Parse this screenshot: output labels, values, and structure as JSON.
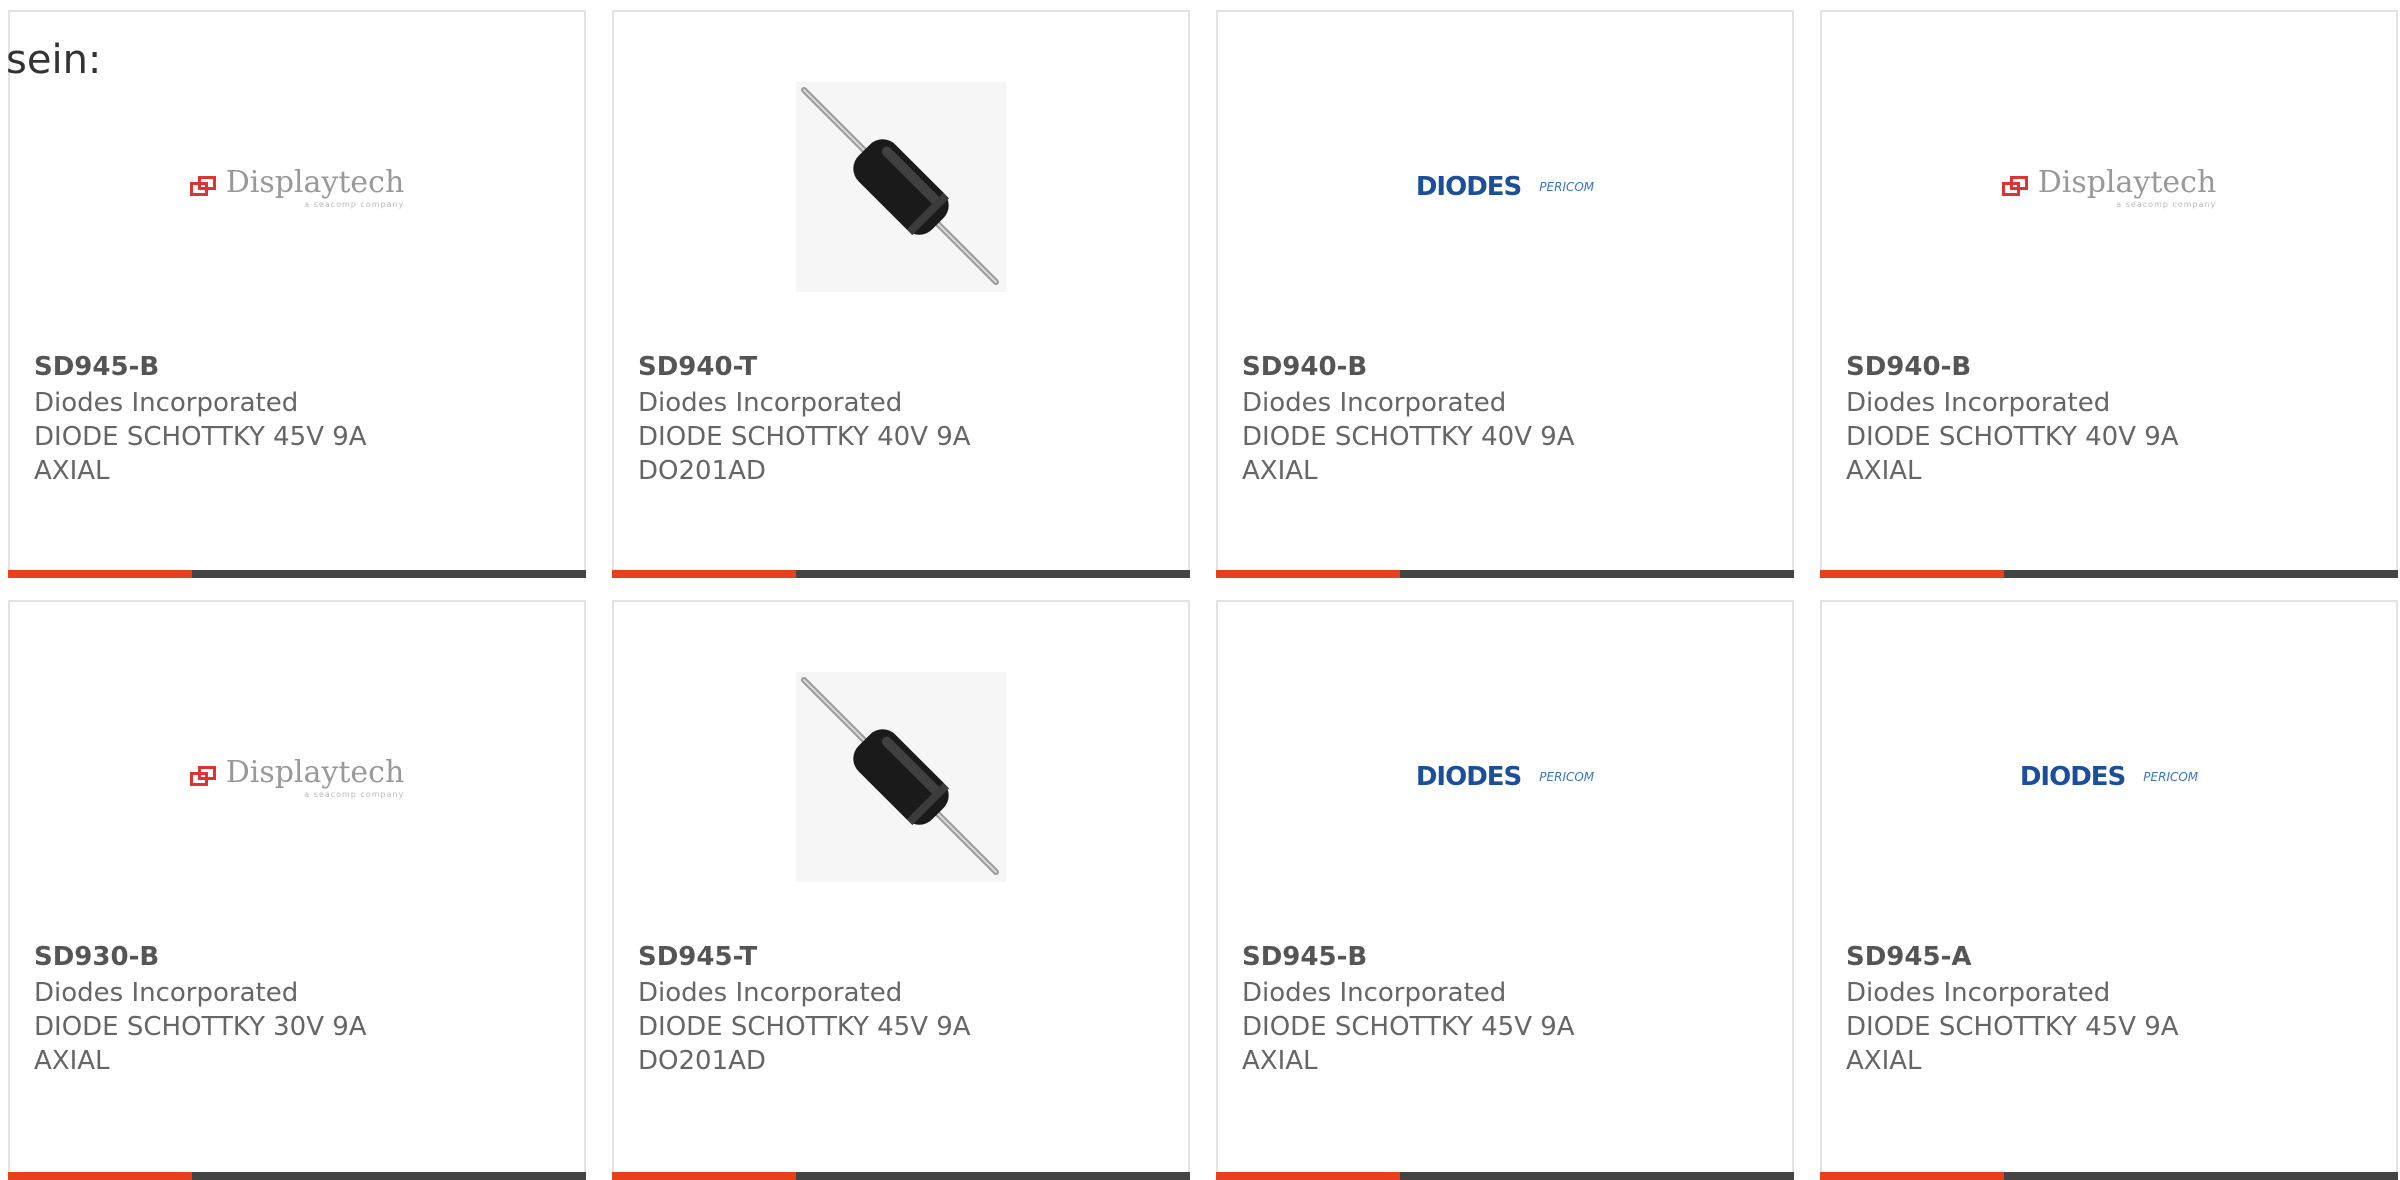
{
  "heading": "sein:",
  "accent_color": "#e8401c",
  "cards": [
    {
      "part": "SD945-B",
      "manufacturer": "Diodes Incorporated",
      "description": "DIODE SCHOTTKY 45V 9A AXIAL",
      "image": "displaytech-logo"
    },
    {
      "part": "SD940-T",
      "manufacturer": "Diodes Incorporated",
      "description": "DIODE SCHOTTKY 40V 9A DO201AD",
      "image": "axial-diode-photo"
    },
    {
      "part": "SD940-B",
      "manufacturer": "Diodes Incorporated",
      "description": "DIODE SCHOTTKY 40V 9A AXIAL",
      "image": "diodes-logo"
    },
    {
      "part": "SD940-B",
      "manufacturer": "Diodes Incorporated",
      "description": "DIODE SCHOTTKY 40V 9A AXIAL",
      "image": "displaytech-logo"
    },
    {
      "part": "SD930-B",
      "manufacturer": "Diodes Incorporated",
      "description": "DIODE SCHOTTKY 30V 9A AXIAL",
      "image": "displaytech-logo"
    },
    {
      "part": "SD945-T",
      "manufacturer": "Diodes Incorporated",
      "description": "DIODE SCHOTTKY 45V 9A DO201AD",
      "image": "axial-diode-photo"
    },
    {
      "part": "SD945-B",
      "manufacturer": "Diodes Incorporated",
      "description": "DIODE SCHOTTKY 45V 9A AXIAL",
      "image": "diodes-logo"
    },
    {
      "part": "SD945-A",
      "manufacturer": "Diodes Incorporated",
      "description": "DIODE SCHOTTKY 45V 9A AXIAL",
      "image": "diodes-logo"
    }
  ],
  "logos": {
    "displaytech": {
      "name": "Displaytech",
      "tagline": "a seacomp company"
    },
    "diodes": {
      "name": "DIODES",
      "partner": "PERICOM"
    }
  }
}
